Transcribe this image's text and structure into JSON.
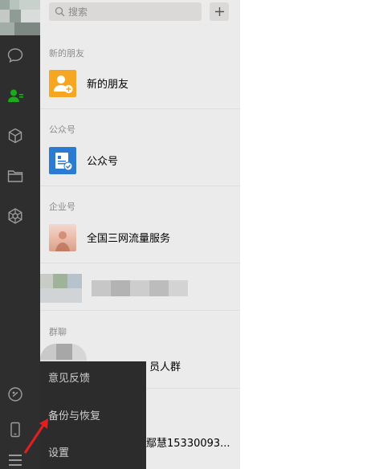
{
  "search": {
    "placeholder": "搜索"
  },
  "sections": {
    "new_friends_header": "新的朋友",
    "official_header": "公众号",
    "enterprise_header": "企业号",
    "groups_header": "群聊"
  },
  "items": {
    "new_friends": "新的朋友",
    "official": "公众号",
    "enterprise_service": "全国三网流量服务",
    "group_partial": "员人群",
    "contact_partial": "鄢慧15330093..."
  },
  "menu": {
    "feedback": "意见反馈",
    "backup": "备份与恢复",
    "settings": "设置"
  },
  "colors": {
    "rail": "#2e2e2e",
    "panel": "#ebebeb",
    "accent_green": "#1aad19",
    "new_friend_orange": "#f5a623",
    "official_blue": "#2b7bd3",
    "annotation_red": "#e02020"
  },
  "icons": {
    "rail": [
      "chat-icon",
      "contacts-icon",
      "collections-cube-icon",
      "folder-icon",
      "mini-program-icon",
      "moments-icon",
      "phone-icon",
      "menu-icon"
    ]
  }
}
